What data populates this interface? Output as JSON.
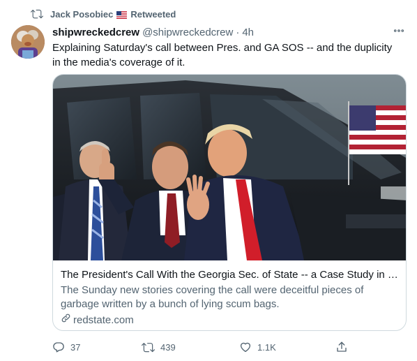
{
  "retweeted_by": {
    "name": "Jack Posobiec",
    "label": "Retweeted",
    "flag": "us-flag-emoji"
  },
  "author": {
    "display_name": "shipwreckedcrew",
    "handle": "@shipwreckedcrew",
    "separator": "·",
    "time": "4h"
  },
  "tweet": {
    "text": "Explaining Saturday's call between Pres. and GA SOS -- and the duplicity in the media's coverage of it."
  },
  "card": {
    "title": "The President's Call With the Georgia Sec. of State -- a Case Study in the...",
    "description": "The Sunday new stories covering the call were deceitful pieces of garbage written by a bunch of lying scum bags.",
    "domain": "redstate.com",
    "image": "photo-of-president-with-georgia-governor"
  },
  "actions": {
    "reply_count": "37",
    "retweet_count": "439",
    "like_count": "1.1K"
  },
  "icons": {
    "retweet": "retweet-icon",
    "more": "more-icon",
    "reply": "reply-icon",
    "like": "heart-icon",
    "share": "share-icon",
    "link": "link-icon"
  },
  "colors": {
    "text_primary": "#0f1419",
    "text_secondary": "#536471",
    "border": "#cfd9de"
  }
}
